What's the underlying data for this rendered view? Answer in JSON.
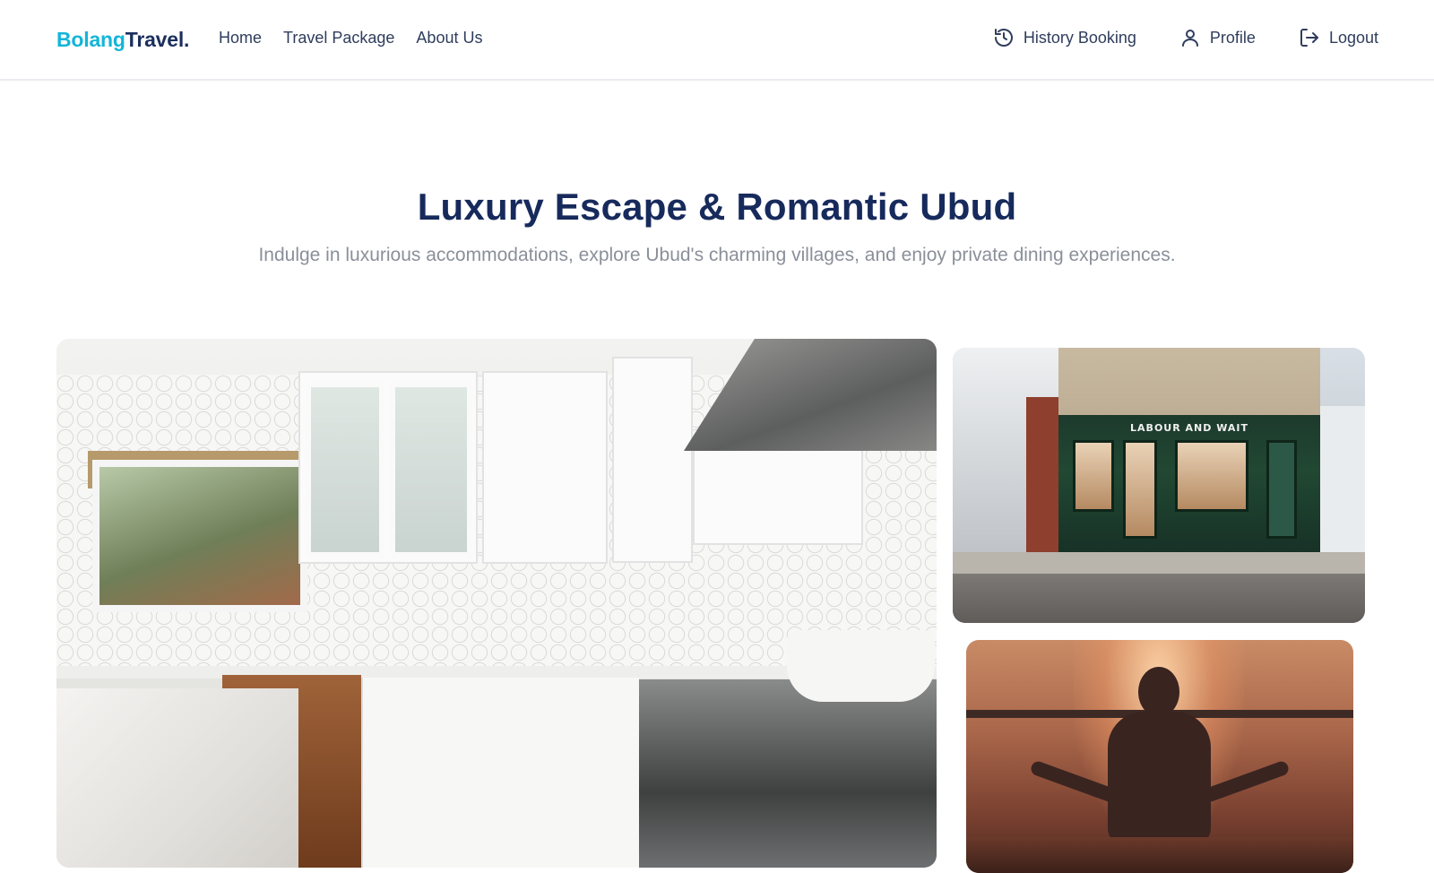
{
  "brand": {
    "part1": "Bolang",
    "part2": "Travel."
  },
  "nav": {
    "links": [
      "Home",
      "Travel Package",
      "About Us"
    ],
    "history_label": "History Booking",
    "profile_label": "Profile",
    "logout_label": "Logout"
  },
  "hero": {
    "title": "Luxury Escape & Romantic Ubud",
    "subtitle": "Indulge in luxurious accommodations, explore Ubud's charming villages, and enjoy private dining experiences."
  },
  "gallery": {
    "street_sign": "LABOUR AND WAIT"
  },
  "icons": {
    "history": "history-icon",
    "profile": "user-icon",
    "logout": "logout-icon"
  },
  "colors": {
    "brand_accent": "#13b5d8",
    "brand_dark": "#1b2f5e",
    "title": "#172a5c",
    "subtitle": "#8a8f99"
  }
}
